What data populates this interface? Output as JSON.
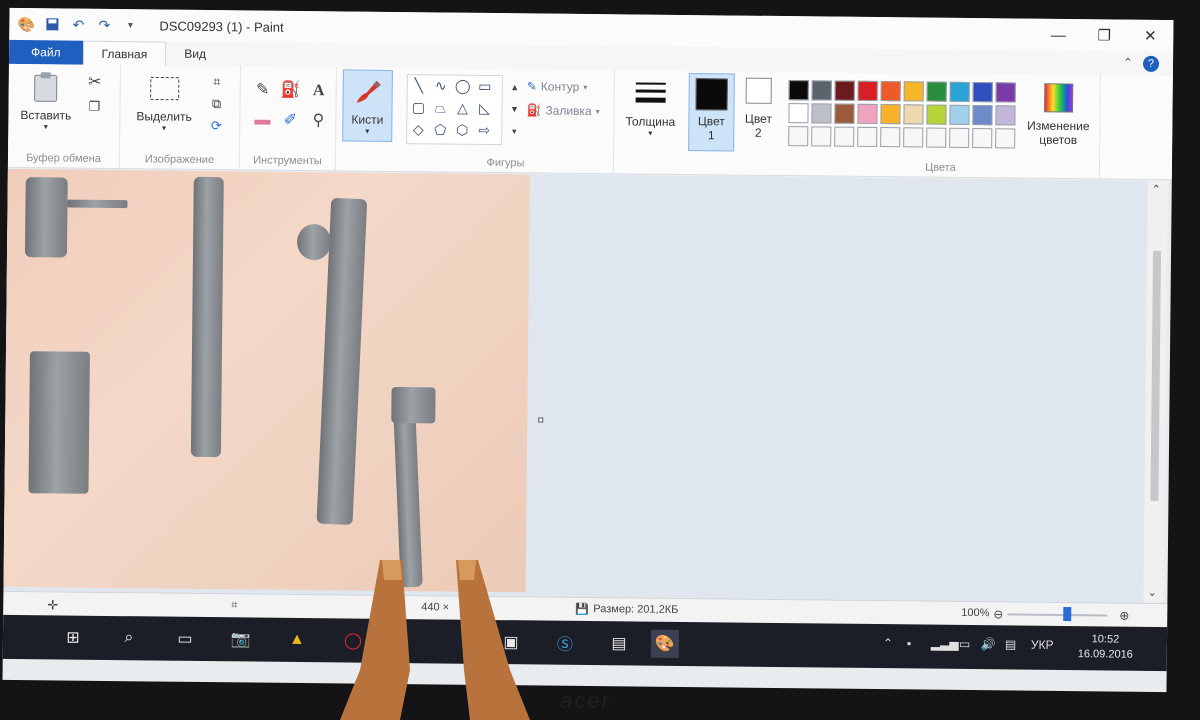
{
  "titlebar": {
    "title": "DSC09293 (1) - Paint",
    "minimize": "—",
    "maximize": "❐",
    "close": "✕"
  },
  "tabs": {
    "file": "Файл",
    "home": "Главная",
    "view": "Вид"
  },
  "ribbon": {
    "clipboard": {
      "paste": "Вставить",
      "label": "Буфер обмена"
    },
    "image": {
      "select": "Выделить",
      "label": "Изображение"
    },
    "tools": {
      "label": "Инструменты"
    },
    "brushes": {
      "label": "Кисти"
    },
    "shapes": {
      "outline": "Контур",
      "fill": "Заливка",
      "label": "Фигуры"
    },
    "size": {
      "label": "Толщина"
    },
    "color1": {
      "label_a": "Цвет",
      "label_b": "1"
    },
    "color2": {
      "label_a": "Цвет",
      "label_b": "2"
    },
    "colors": {
      "label": "Цвета",
      "edit_a": "Изменение",
      "edit_b": "цветов"
    }
  },
  "palette": {
    "row1": [
      "#0a0a0a",
      "#5d636c",
      "#6b1a1e",
      "#d81e26",
      "#ee5a2a",
      "#f7b72a",
      "#2a8f3c",
      "#2aa3d9",
      "#2f4fbf",
      "#7b3aa8"
    ],
    "row2": [
      "#ffffff",
      "#bcc0c6",
      "#9c5a3c",
      "#efa3bf",
      "#f7b12a",
      "#ecd9b0",
      "#b6d33a",
      "#9fd2ea",
      "#6c8bc8",
      "#c3b6d9"
    ],
    "row3": [
      "#f7f7f7",
      "#f7f7f7",
      "#f7f7f7",
      "#f7f7f7",
      "#f7f7f7",
      "#f7f7f7",
      "#f7f7f7",
      "#f7f7f7",
      "#f7f7f7",
      "#f7f7f7"
    ]
  },
  "status": {
    "dims": "440 ×",
    "size_label": "Размер: 201,2КБ",
    "zoom": "100%"
  },
  "taskbar": {
    "lang": "УКР",
    "time": "10:52",
    "date": "16.09.2016"
  },
  "colors": {
    "accent": "#1e5fbf",
    "taskbar": "#1b1e26"
  }
}
